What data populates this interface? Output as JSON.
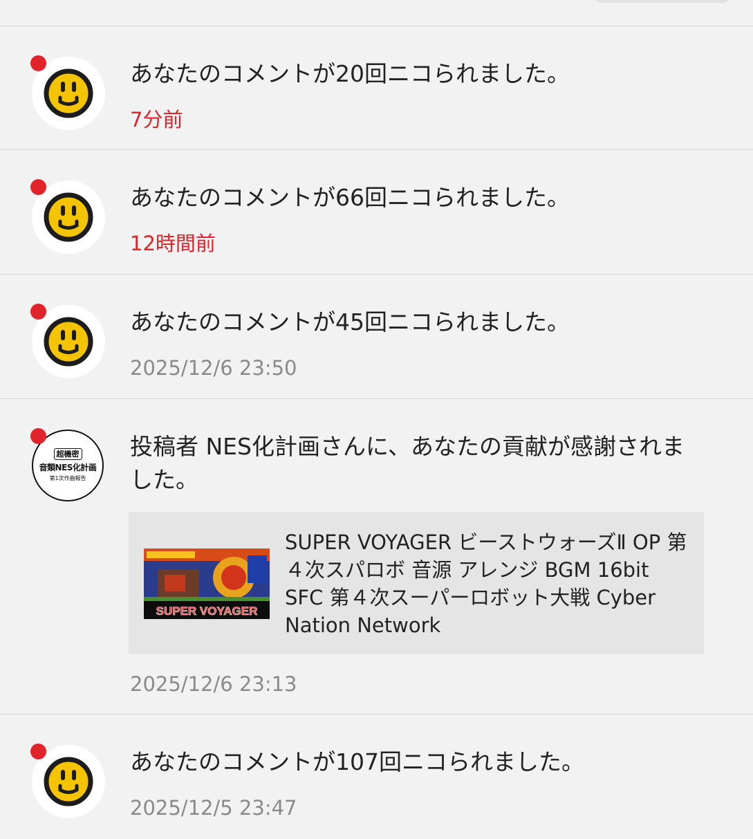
{
  "notifications": [
    {
      "message": "あなたのコメントが20回ニコられました。",
      "time": "7分前"
    },
    {
      "message": "あなたのコメントが66回ニコられました。",
      "time": "12時間前"
    },
    {
      "message": "あなたのコメントが45回ニコられました。",
      "time": "2025/12/6 23:50"
    },
    {
      "message": "投稿者 NES化計画さんに、あなたの貢献が感謝されました。",
      "avatar_text": {
        "top": "超機密",
        "middle": "音類NES化計画",
        "bottom": "第1次作曲報告"
      },
      "video": {
        "title": "SUPER VOYAGER ビーストウォーズⅡ OP 第４次スパロボ 音源 アレンジ BGM 16bit SFC 第４次スーパーロボット大戦 Cyber Nation Network",
        "thumbnail_caption": "SUPER VOYAGER"
      },
      "time": "2025/12/6 23:13"
    },
    {
      "message": "あなたのコメントが107回ニコられました。",
      "time": "2025/12/5 23:47"
    }
  ],
  "colors": {
    "unread_dot": "#e0242b",
    "recent_time": "#e0242b",
    "timestamp": "#8a8a8a",
    "background": "#f2f2f2",
    "smiley_face": "#f5c400"
  },
  "icons": {
    "nicoru": "smiley-face-icon",
    "unread": "red-dot-indicator"
  }
}
